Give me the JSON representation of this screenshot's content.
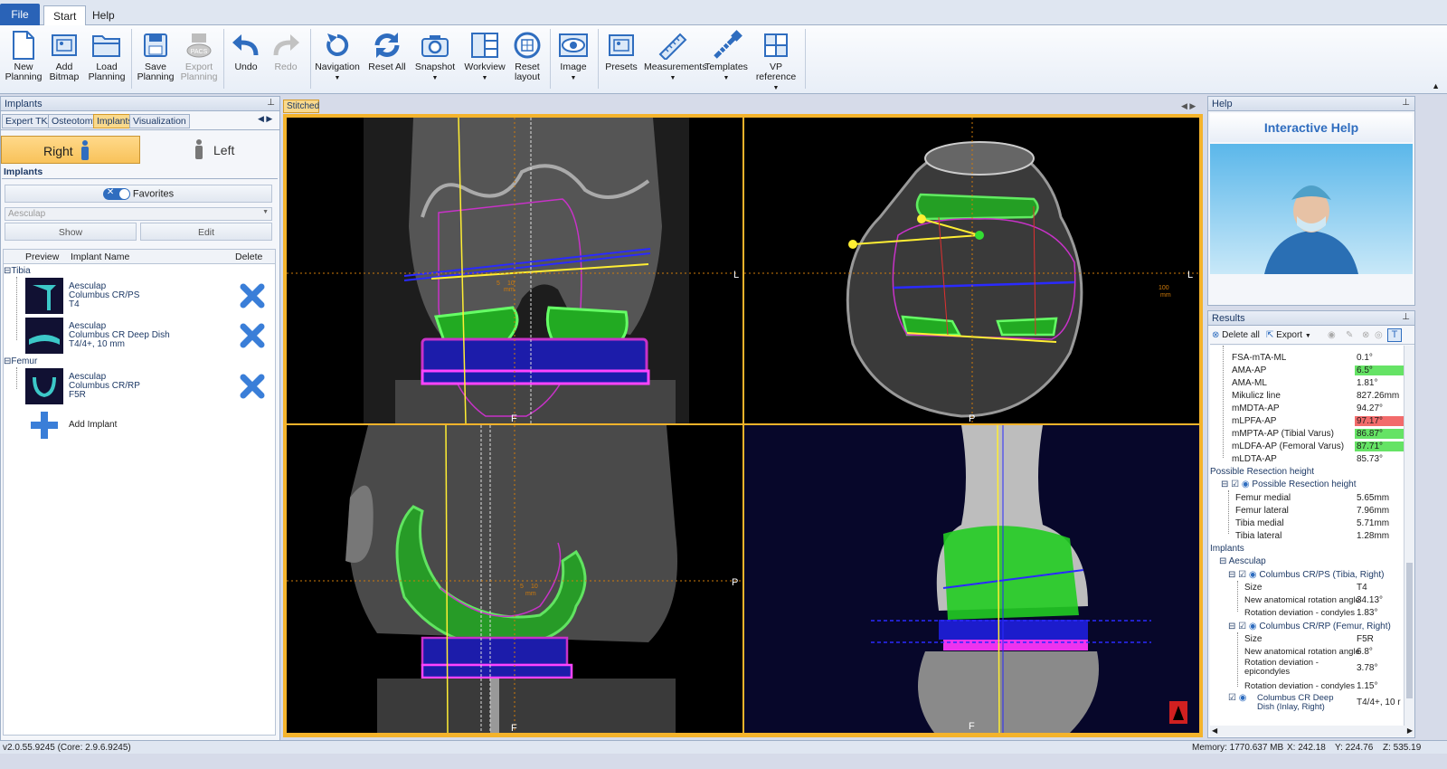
{
  "ribbon_tabs": {
    "file": "File",
    "start": "Start",
    "help": "Help"
  },
  "ribbon": {
    "new_planning": "New\nPlanning",
    "add_bitmap": "Add\nBitmap",
    "load_planning": "Load\nPlanning",
    "save_planning": "Save\nPlanning",
    "export_planning": "Export\nPlanning",
    "pacs": "PACS",
    "undo": "Undo",
    "redo": "Redo",
    "navigation": "Navigation",
    "reset_all": "Reset All",
    "snapshot": "Snapshot",
    "workview": "Workview",
    "reset_layout": "Reset\nlayout",
    "image": "Image",
    "presets": "Presets",
    "measurements": "Measurements",
    "templates": "Templates",
    "vp_reference": "VP reference"
  },
  "left": {
    "title": "Implants",
    "tabs": [
      "Expert TKA",
      "Osteotomy",
      "Implants",
      "Visualization"
    ],
    "side_right": "Right",
    "side_left": "Left",
    "section": "Implants",
    "favorites": "Favorites",
    "manufacturer": "Aesculap",
    "show": "Show",
    "edit": "Edit",
    "cols": {
      "preview": "Preview",
      "name": "Implant Name",
      "delete": "Delete"
    },
    "groups": {
      "tibia": "Tibia",
      "femur": "Femur"
    },
    "implants": [
      {
        "l1": "Aesculap",
        "l2": "Columbus CR/PS",
        "l3": "T4"
      },
      {
        "l1": "Aesculap",
        "l2": "Columbus CR Deep Dish",
        "l3": "T4/4+, 10 mm"
      },
      {
        "l1": "Aesculap",
        "l2": "Columbus CR/RP",
        "l3": "F5R"
      }
    ],
    "add_implant": "Add Implant"
  },
  "viewer": {
    "tab": "Stitched",
    "labels": {
      "q1_right": "L",
      "q1_bottom": "F",
      "q2_right": "L",
      "q2_bottom": "P",
      "q3_right": "P",
      "q3_bottom": "F",
      "q4_bottom": "F"
    },
    "scale": {
      "five": "5",
      "ten": "10",
      "mm": "mm",
      "hundred": "100"
    }
  },
  "help": {
    "title": "Help",
    "heading": "Interactive Help"
  },
  "results": {
    "title": "Results",
    "delete_all": "Delete all",
    "export": "Export",
    "rows": [
      {
        "l": "FSA-mTA-ML",
        "v": "0.1°",
        "hl": ""
      },
      {
        "l": "AMA-AP",
        "v": "6.5°",
        "hl": "green"
      },
      {
        "l": "AMA-ML",
        "v": "1.81°",
        "hl": ""
      },
      {
        "l": "Mikulicz line",
        "v": "827.26mm",
        "hl": ""
      },
      {
        "l": "mMDTA-AP",
        "v": "94.27°",
        "hl": ""
      },
      {
        "l": "mLPFA-AP",
        "v": "97.17°",
        "hl": "red"
      },
      {
        "l": "mMPTA-AP (Tibial Varus)",
        "v": "86.87°",
        "hl": "green"
      },
      {
        "l": "mLDFA-AP (Femoral Varus)",
        "v": "87.71°",
        "hl": "green"
      },
      {
        "l": "mLDTA-AP",
        "v": "85.73°",
        "hl": ""
      }
    ],
    "resection_group": "Possible Resection height",
    "resection_item": "Possible Resection height",
    "resection_rows": [
      {
        "l": "Femur medial",
        "v": "5.65mm"
      },
      {
        "l": "Femur lateral",
        "v": "7.96mm"
      },
      {
        "l": "Tibia medial",
        "v": "5.71mm"
      },
      {
        "l": "Tibia lateral",
        "v": "1.28mm"
      }
    ],
    "implants_group": "Implants",
    "aesculap": "Aesculap",
    "tibia_item": "Columbus CR/PS (Tibia, Right)",
    "tibia_rows": [
      {
        "l": "Size",
        "v": "T4"
      },
      {
        "l": "New anatomical rotation angle",
        "v": "34.13°"
      },
      {
        "l": "Rotation deviation - condyles",
        "v": "1.83°"
      }
    ],
    "femur_item": "Columbus CR/RP (Femur, Right)",
    "femur_rows": [
      {
        "l": "Size",
        "v": "F5R"
      },
      {
        "l": "New anatomical rotation angle",
        "v": "6.8°"
      },
      {
        "l": "Rotation deviation -",
        "l2": "epicondyles",
        "v": "3.78°"
      },
      {
        "l": "Rotation deviation - condyles",
        "v": "1.15°"
      }
    ],
    "inlay_l1": "Columbus CR Deep",
    "inlay_l2": "Dish (Inlay, Right)",
    "inlay_v": "T4/4+, 10 r"
  },
  "status": {
    "version": "v2.0.55.9245 (Core: 2.9.6.9245)",
    "memory": "Memory: 1770.637 MB",
    "x": "X: 242.18",
    "y": "Y: 224.76",
    "z": "Z: 535.19"
  }
}
